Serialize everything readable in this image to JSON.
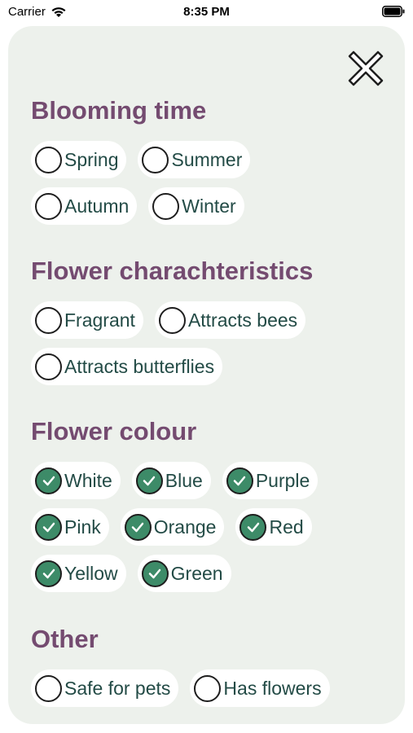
{
  "status_bar": {
    "carrier": "Carrier",
    "time": "8:35 PM"
  },
  "colors": {
    "heading": "#744b70",
    "sheet_background": "#edf1ec",
    "checked": "#3d8b68",
    "label": "#234b46"
  },
  "close_icon": "close-icon",
  "sections": {
    "blooming_time": {
      "title": "Blooming time",
      "options": [
        {
          "label": "Spring",
          "checked": false
        },
        {
          "label": "Summer",
          "checked": false
        },
        {
          "label": "Autumn",
          "checked": false
        },
        {
          "label": "Winter",
          "checked": false
        }
      ]
    },
    "characteristics": {
      "title": "Flower charachteristics",
      "options": [
        {
          "label": "Fragrant",
          "checked": false
        },
        {
          "label": "Attracts bees",
          "checked": false
        },
        {
          "label": "Attracts butterflies",
          "checked": false
        }
      ]
    },
    "colour": {
      "title": "Flower colour",
      "options": [
        {
          "label": "White",
          "checked": true
        },
        {
          "label": "Blue",
          "checked": true
        },
        {
          "label": "Purple",
          "checked": true
        },
        {
          "label": "Pink",
          "checked": true
        },
        {
          "label": "Orange",
          "checked": true
        },
        {
          "label": "Red",
          "checked": true
        },
        {
          "label": "Yellow",
          "checked": true
        },
        {
          "label": "Green",
          "checked": true
        }
      ]
    },
    "other": {
      "title": "Other",
      "options": [
        {
          "label": "Safe for pets",
          "checked": false
        },
        {
          "label": "Has flowers",
          "checked": false
        }
      ]
    }
  }
}
